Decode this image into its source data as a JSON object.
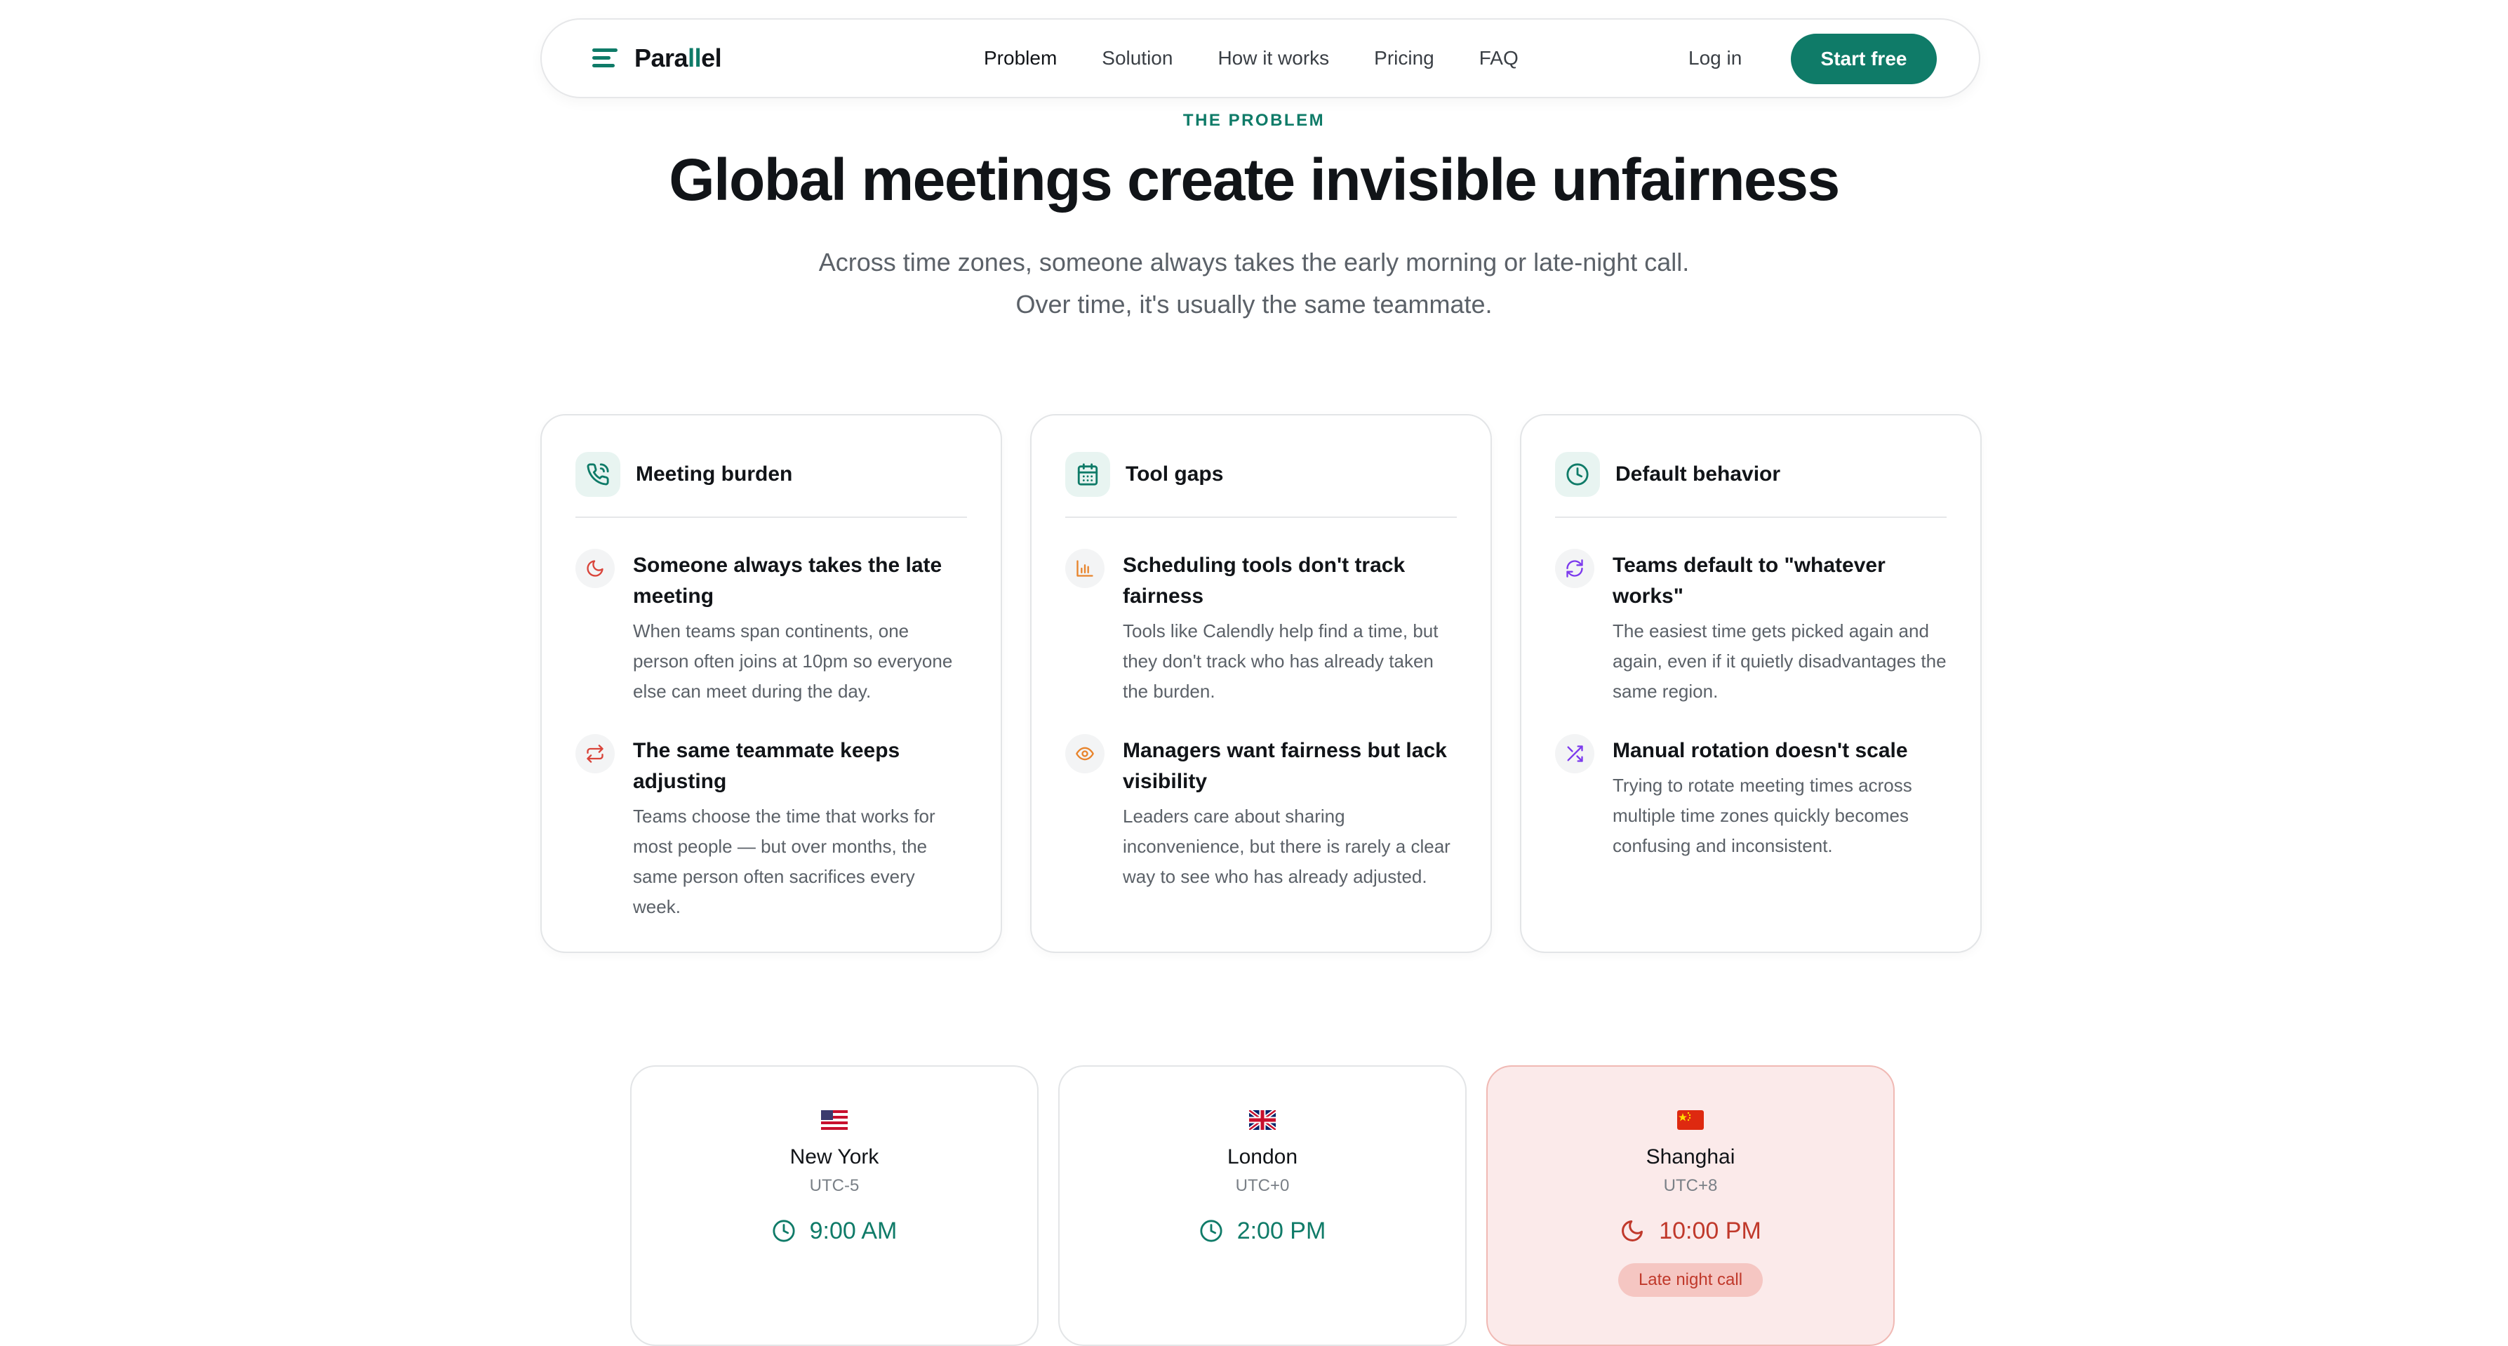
{
  "nav": {
    "logo_text_a": "Para",
    "logo_text_b": "ll",
    "logo_text_c": "el",
    "links": [
      "Problem",
      "Solution",
      "How it works",
      "Pricing",
      "FAQ"
    ],
    "active": "Problem",
    "login": "Log in",
    "cta": "Start free"
  },
  "hero": {
    "eyebrow": "THE PROBLEM",
    "title": "Global meetings create invisible unfairness",
    "subtitle_line1": "Across time zones, someone always takes the early morning or late-night call.",
    "subtitle_line2": "Over time, it's usually the same teammate."
  },
  "cards": [
    {
      "title": "Meeting burden",
      "icon": "phone-icon",
      "items": [
        {
          "icon": "moon-icon",
          "title": "Someone always takes the late meeting",
          "body": "When teams span continents, one person often joins at 10pm so everyone else can meet during the day."
        },
        {
          "icon": "swap-icon",
          "title": "The same teammate keeps adjusting",
          "body": "Teams choose the time that works for most people — but over months, the same person often sacrifices every week."
        }
      ]
    },
    {
      "title": "Tool gaps",
      "icon": "calendar-icon",
      "items": [
        {
          "icon": "bar-chart-icon",
          "title": "Scheduling tools don't track fairness",
          "body": "Tools like Calendly help find a time, but they don't track who has already taken the burden."
        },
        {
          "icon": "eye-icon",
          "title": "Managers want fairness but lack visibility",
          "body": "Leaders care about sharing inconvenience, but there is rarely a clear way to see who has already adjusted."
        }
      ]
    },
    {
      "title": "Default behavior",
      "icon": "clock-icon",
      "items": [
        {
          "icon": "refresh-icon",
          "title": "Teams default to \"whatever works\"",
          "body": "The easiest time gets picked again and again, even if it quietly disadvantages the same region."
        },
        {
          "icon": "shuffle-icon",
          "title": "Manual rotation doesn't scale",
          "body": "Trying to rotate meeting times across multiple time zones quickly becomes confusing and inconsistent."
        }
      ]
    }
  ],
  "timezones": [
    {
      "flag": "us-flag-icon",
      "city": "New York",
      "utc": "UTC-5",
      "time": "9:00 AM",
      "time_icon": "clock-icon"
    },
    {
      "flag": "uk-flag-icon",
      "city": "London",
      "utc": "UTC+0",
      "time": "2:00 PM",
      "time_icon": "clock-icon"
    },
    {
      "flag": "cn-flag-icon",
      "city": "Shanghai",
      "utc": "UTC+8",
      "time": "10:00 PM",
      "time_icon": "moon-icon",
      "badge": "Late night call"
    }
  ],
  "colors": {
    "brand": "#0f7b68",
    "late_bg": "#fbeaea",
    "late_text": "#c0392b",
    "orange_icon": "#e8842c",
    "purple_icon": "#7c3aed",
    "red_icon": "#d9443a"
  }
}
